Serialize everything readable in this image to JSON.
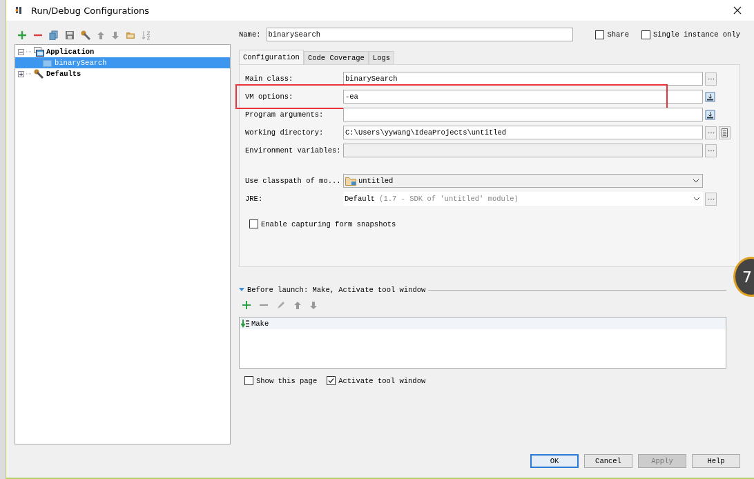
{
  "window": {
    "title": "Run/Debug Configurations"
  },
  "tree": [
    {
      "label": "Application",
      "expanded": true,
      "selected": false,
      "children": [
        {
          "label": "binarySearch",
          "selected": true
        }
      ]
    },
    {
      "label": "Defaults",
      "expanded": false,
      "selected": false
    }
  ],
  "name_field": {
    "label": "Name:",
    "value": "binarySearch"
  },
  "header_options": [
    {
      "label": "Share",
      "checked": false
    },
    {
      "label": "Single instance only",
      "checked": false
    }
  ],
  "tabs": [
    {
      "label": "Configuration",
      "selected": true
    },
    {
      "label": "Code Coverage",
      "selected": false
    },
    {
      "label": "Logs",
      "selected": false
    }
  ],
  "fields": [
    {
      "kind": "text",
      "label": "Main class:",
      "value": "binarySearch",
      "highlighted": false
    },
    {
      "kind": "expand",
      "label": "VM options:",
      "value": "-ea",
      "highlighted": true
    },
    {
      "kind": "expand",
      "label": "Program arguments:",
      "highlighted": false
    },
    {
      "kind": "directory",
      "label": "Working directory:",
      "value": "C:\\Users\\yywang\\IdeaProjects\\untitled",
      "highlighted": false
    },
    {
      "kind": "disabled",
      "label": "Environment variables:",
      "highlighted": false
    },
    {
      "kind": "module",
      "label": "Use classpath of mo...",
      "value": "untitled",
      "highlighted": false
    },
    {
      "kind": "jre",
      "label": "JRE:",
      "value": "Default",
      "hint": "(1.7 - SDK of 'untitled' module)",
      "highlighted": false
    }
  ],
  "snapshot_option": {
    "label": "Enable capturing form snapshots",
    "checked": false
  },
  "before_launch": {
    "title": "Before launch: Make, Activate tool window",
    "expanded": true,
    "tasks": [
      {
        "label": "Make"
      }
    ]
  },
  "bottom_options": [
    {
      "label": "Show this page",
      "checked": false
    },
    {
      "label": "Activate tool window",
      "checked": true
    }
  ],
  "buttons": [
    {
      "label": "OK",
      "default": true,
      "disabled": false
    },
    {
      "label": "Cancel",
      "default": false,
      "disabled": false
    },
    {
      "label": "Apply",
      "default": false,
      "disabled": true
    },
    {
      "label": "Help",
      "default": false,
      "disabled": false
    }
  ],
  "floating_badge": "7"
}
